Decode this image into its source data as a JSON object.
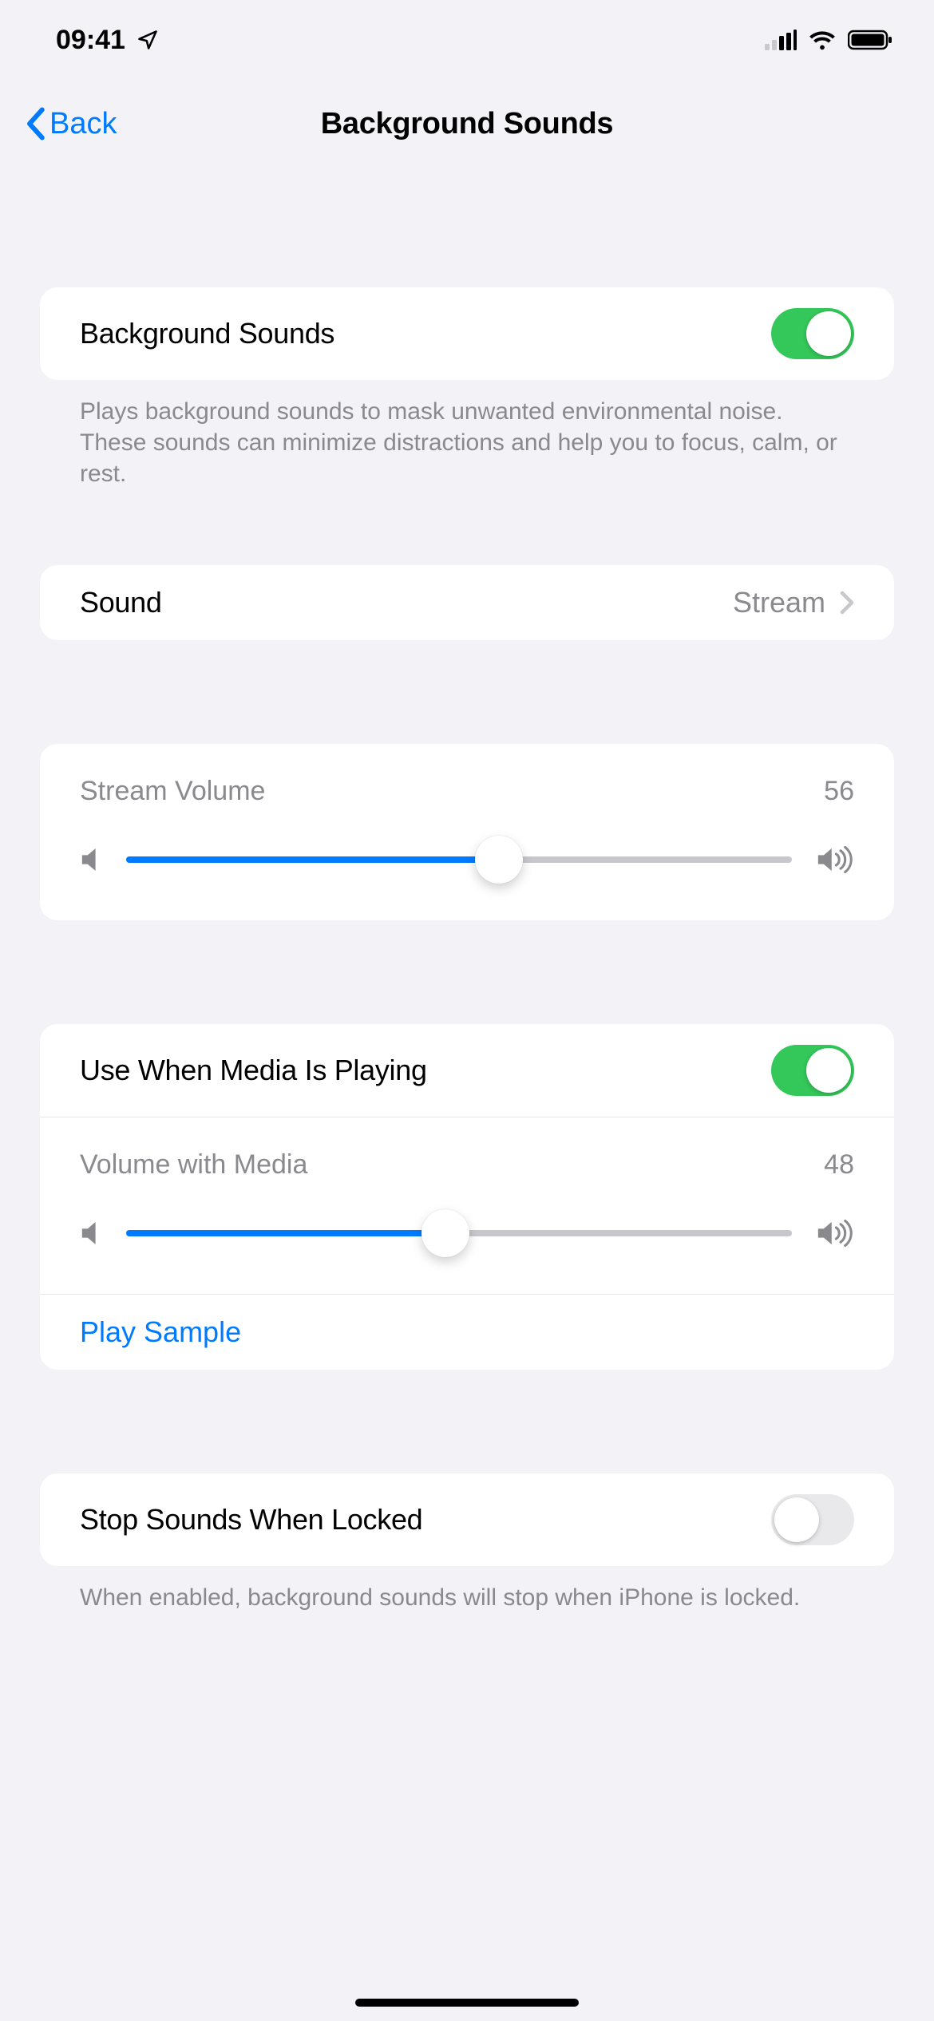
{
  "statusBar": {
    "time": "09:41"
  },
  "nav": {
    "back": "Back",
    "title": "Background Sounds"
  },
  "sections": {
    "enable": {
      "label": "Background Sounds",
      "on": true,
      "footer": "Plays background sounds to mask unwanted environmental noise. These sounds can minimize distractions and help you to focus, calm, or rest."
    },
    "sound": {
      "label": "Sound",
      "value": "Stream"
    },
    "streamVolume": {
      "label": "Stream Volume",
      "value": 56
    },
    "media": {
      "useWhenPlaying": {
        "label": "Use When Media Is Playing",
        "on": true
      },
      "volumeWithMedia": {
        "label": "Volume with Media",
        "value": 48
      },
      "playSample": "Play Sample"
    },
    "stopWhenLocked": {
      "label": "Stop Sounds When Locked",
      "on": false,
      "footer": "When enabled, background sounds will stop when iPhone is locked."
    }
  }
}
